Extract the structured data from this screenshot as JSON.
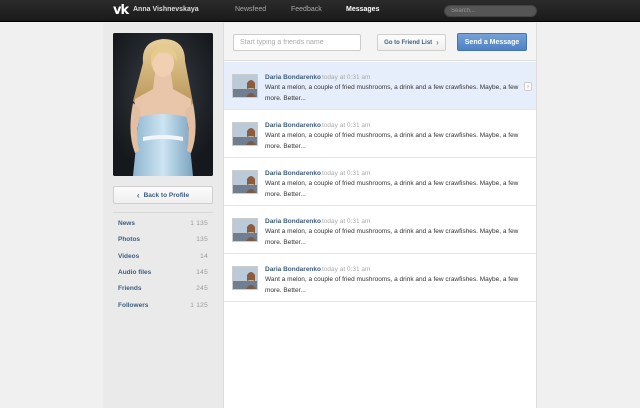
{
  "topbar": {
    "logo": "vk",
    "username": "Anna Vishnevskaya",
    "nav": [
      {
        "label": "Newsfeed",
        "active": false
      },
      {
        "label": "Feedback",
        "active": false
      },
      {
        "label": "Messages",
        "active": true
      }
    ],
    "search_placeholder": "Search..."
  },
  "sidebar": {
    "back_label": "Back to Profile",
    "items": [
      {
        "label": "News",
        "count": "1 135"
      },
      {
        "label": "Photos",
        "count": "135"
      },
      {
        "label": "Videos",
        "count": "14"
      },
      {
        "label": "Audio files",
        "count": "145"
      },
      {
        "label": "Friends",
        "count": "245"
      },
      {
        "label": "Followers",
        "count": "1 125"
      }
    ]
  },
  "header": {
    "friend_input_placeholder": "Start typing a friends name",
    "friend_list_label": "Go to Friend List",
    "send_label": "Send a Message"
  },
  "messages": [
    {
      "author": "Daria Bondarenko",
      "time": "today at 0:31 am",
      "text": "Want a melon, a couple of fried mushrooms, a drink and a few crawfishes. Maybe, a few more. Better...",
      "selected": true
    },
    {
      "author": "Daria Bondarenko",
      "time": "today at 0:31 am",
      "text": "Want a melon, a couple of fried mushrooms, a drink and a few crawfishes. Maybe, a few more. Better...",
      "selected": false
    },
    {
      "author": "Daria Bondarenko",
      "time": "today at 0:31 am",
      "text": "Want a melon, a couple of fried mushrooms, a drink and a few crawfishes. Maybe, a few more. Better...",
      "selected": false
    },
    {
      "author": "Daria Bondarenko",
      "time": "today at 0:31 am",
      "text": "Want a melon, a couple of fried mushrooms, a drink and a few crawfishes. Maybe, a few more. Better...",
      "selected": false
    },
    {
      "author": "Daria Bondarenko",
      "time": "today at 0:31 am",
      "text": "Want a melon, a couple of fried mushrooms, a drink and a few crawfishes. Maybe, a few more. Better...",
      "selected": false
    }
  ],
  "colors": {
    "accent": "#4f82c4",
    "link": "#3d5e80",
    "topbar": "#1f1f1f",
    "selected_row": "#e5eefa"
  }
}
